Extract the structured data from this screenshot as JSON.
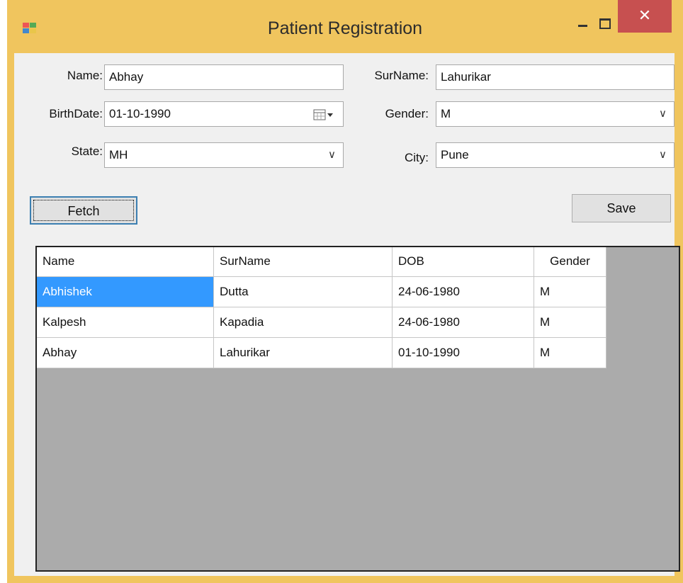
{
  "window": {
    "title": "Patient Registration",
    "close_glyph": "✕"
  },
  "form": {
    "name_label": "Name:",
    "name_value": "Abhay",
    "surname_label": "SurName:",
    "surname_value": "Lahurikar",
    "birthdate_label": "BirthDate:",
    "birthdate_value": "01-10-1990",
    "gender_label": "Gender:",
    "gender_value": "M",
    "state_label": "State:",
    "state_value": "MH",
    "city_label": "City:",
    "city_value": "Pune"
  },
  "buttons": {
    "fetch": "Fetch",
    "save": "Save"
  },
  "grid": {
    "columns": [
      "Name",
      "SurName",
      "DOB",
      "Gender"
    ],
    "rows": [
      [
        "Abhishek",
        "Dutta",
        "24-06-1980",
        "M"
      ],
      [
        "Kalpesh",
        "Kapadia",
        "24-06-1980",
        "M"
      ],
      [
        "Abhay",
        "Lahurikar",
        "01-10-1990",
        "M"
      ]
    ]
  },
  "icons": {
    "dropdown": "chevron-down-icon",
    "calendar": "calendar-icon"
  }
}
